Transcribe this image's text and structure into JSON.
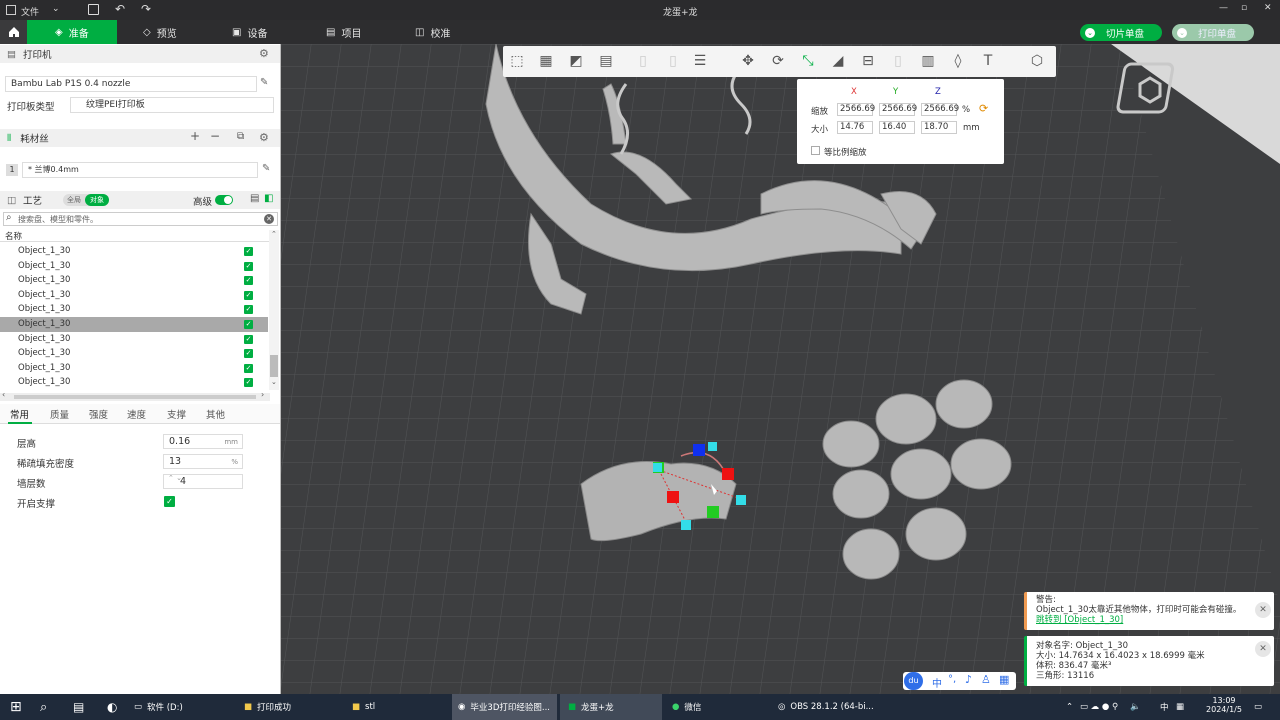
{
  "window": {
    "title": "龙蛋+龙",
    "file_menu": "文件"
  },
  "nav": {
    "tabs": [
      {
        "label": "准备"
      },
      {
        "label": "预览"
      },
      {
        "label": "设备"
      },
      {
        "label": "项目"
      },
      {
        "label": "校准"
      }
    ],
    "slice_button": "切片单盘",
    "print_button": "打印单盘"
  },
  "printer": {
    "section": "打印机",
    "name": "Bambu Lab P1S 0.4 nozzle",
    "plate_label": "打印板类型",
    "plate_value": "纹理PEI打印板"
  },
  "filament": {
    "section": "耗材丝",
    "index": "1",
    "name": "* 兰博0.4mm"
  },
  "process": {
    "section": "工艺",
    "toggle_global": "全局",
    "toggle_object": "对象",
    "advanced": "高级",
    "search_placeholder": "搜索盘、模型和零件。",
    "column_name": "名称",
    "objects": [
      "Object_1_30",
      "Object_1_30",
      "Object_1_30",
      "Object_1_30",
      "Object_1_30",
      "Object_1_30",
      "Object_1_30",
      "Object_1_30",
      "Object_1_30",
      "Object_1_30"
    ],
    "selected_index": 5
  },
  "param_tabs": [
    "常用",
    "质量",
    "强度",
    "速度",
    "支撑",
    "其他"
  ],
  "params": [
    {
      "label": "层高",
      "value": "0.16",
      "unit": "mm"
    },
    {
      "label": "稀疏填充密度",
      "value": "13",
      "unit": "%"
    },
    {
      "label": "墙层数",
      "value": "4",
      "unit": ""
    },
    {
      "label": "开启支撑",
      "value": "",
      "unit": ""
    }
  ],
  "scale": {
    "x": "X",
    "y": "Y",
    "z": "Z",
    "scale_label": "缩放",
    "size_label": "大小",
    "scale_x": "2566.69",
    "scale_y": "2566.69",
    "scale_z": "2566.69",
    "scale_unit": "%",
    "size_x": "14.76",
    "size_y": "16.40",
    "size_z": "18.70",
    "size_unit": "mm",
    "uniform": "等比例缩放"
  },
  "warning": {
    "title": "警告:",
    "text": "Object_1_30太靠近其他物体，打印时可能会有碰撞。",
    "link": "跳转到 [Object_1_30]"
  },
  "info": {
    "name": "对象名字: Object_1_30",
    "size": "大小:  14.7634 x 16.4023 x 18.6999 毫米",
    "volume": "体积:  836.47 毫米³",
    "triangles": "三角形:  13116"
  },
  "ime": {
    "label": "中"
  },
  "taskbar": {
    "items": [
      "软件 (D:)",
      "打印成功",
      "stl",
      "毕业3D打印经验图...",
      "龙蛋+龙",
      "微信",
      "OBS 28.1.2 (64-bi..."
    ],
    "lang": "中",
    "time": "13:09",
    "date": "2024/1/5"
  },
  "colors": {
    "accent": "#00ae42"
  }
}
